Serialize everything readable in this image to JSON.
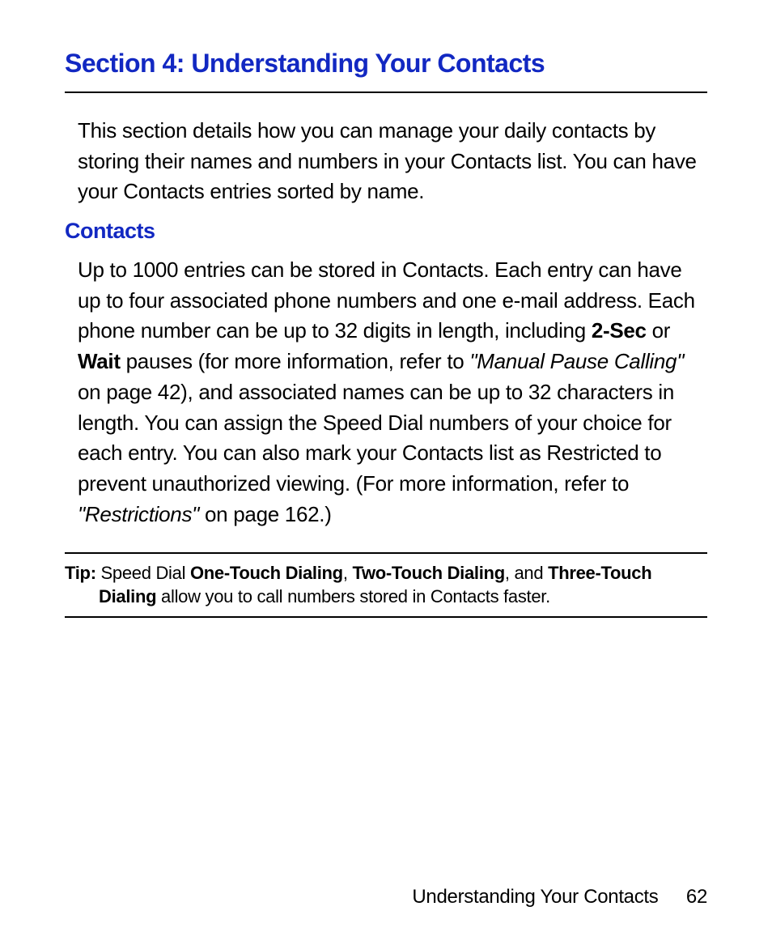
{
  "section_title": "Section 4: Understanding Your Contacts",
  "intro": "This section details how you can manage your daily contacts by storing their names and numbers in your Contacts list. You can have your Contacts entries sorted by name.",
  "subsection_title": "Contacts",
  "body": {
    "part1": "Up to 1000 entries can be stored in Contacts. Each entry can have up to four associated phone numbers and one e-mail address. Each phone number can be up to 32 digits in length, including ",
    "bold1": "2-Sec",
    "part2": " or ",
    "bold2": "Wait",
    "part3": " pauses (for more information, refer to ",
    "italic1": "\"Manual Pause Calling\"",
    "part4": " on page 42), and associated names can be up to 32 characters in length. You can assign the Speed Dial numbers of your choice for each entry. You can also mark your Contacts list as Restricted to prevent unauthorized viewing. (For more information, refer to ",
    "italic2": "\"Restrictions\"",
    "part5": " on page 162.)"
  },
  "tip": {
    "label": "Tip:",
    "part1": " Speed Dial ",
    "bold1": "One-Touch Dialing",
    "part2": ", ",
    "bold2": "Two-Touch Dialing",
    "part3": ", and ",
    "bold3": "Three-Touch Dialing",
    "part4": " allow you to call numbers stored in Contacts faster."
  },
  "footer": {
    "title": "Understanding Your Contacts",
    "page": "62"
  }
}
